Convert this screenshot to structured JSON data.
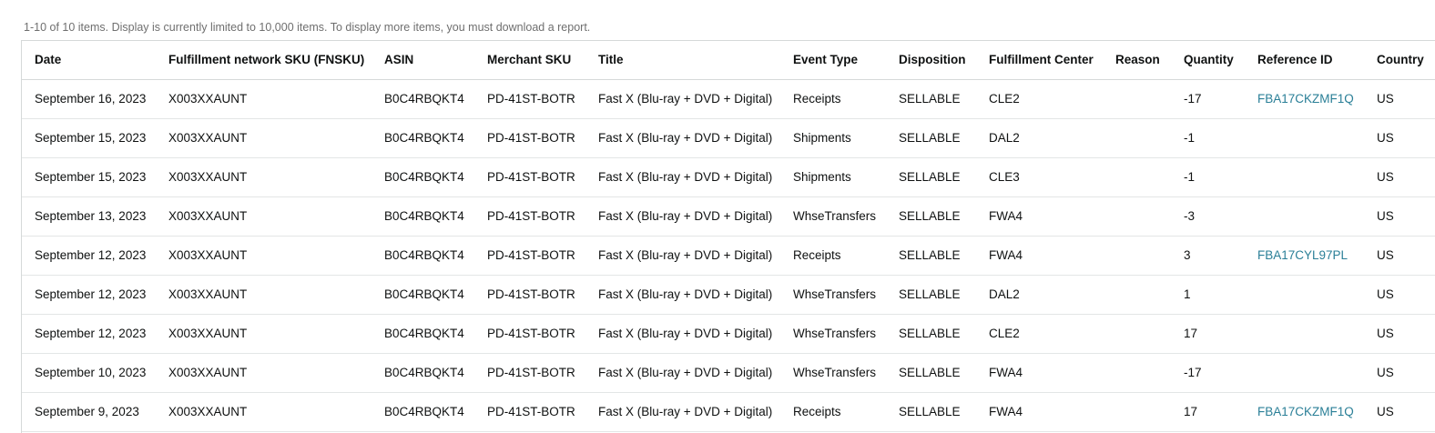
{
  "notice": "1-10 of 10 items. Display is currently limited to 10,000 items. To display more items, you must download a report.",
  "columns": {
    "date": "Date",
    "fnsku": "Fulfillment network SKU (FNSKU)",
    "asin": "ASIN",
    "merchant_sku": "Merchant SKU",
    "title": "Title",
    "event_type": "Event Type",
    "disposition": "Disposition",
    "fulfillment_center": "Fulfillment Center",
    "reason": "Reason",
    "quantity": "Quantity",
    "reference_id": "Reference ID",
    "country": "Country"
  },
  "rows": [
    {
      "date": "September 16, 2023",
      "fnsku": "X003XXAUNT",
      "asin": "B0C4RBQKT4",
      "merchant_sku": "PD-41ST-BOTR",
      "title": "Fast X (Blu-ray + DVD + Digital)",
      "event_type": "Receipts",
      "disposition": "SELLABLE",
      "fulfillment_center": "CLE2",
      "reason": "",
      "quantity": "-17",
      "reference_id": "FBA17CKZMF1Q",
      "country": "US"
    },
    {
      "date": "September 15, 2023",
      "fnsku": "X003XXAUNT",
      "asin": "B0C4RBQKT4",
      "merchant_sku": "PD-41ST-BOTR",
      "title": "Fast X (Blu-ray + DVD + Digital)",
      "event_type": "Shipments",
      "disposition": "SELLABLE",
      "fulfillment_center": "DAL2",
      "reason": "",
      "quantity": "-1",
      "reference_id": "",
      "country": "US"
    },
    {
      "date": "September 15, 2023",
      "fnsku": "X003XXAUNT",
      "asin": "B0C4RBQKT4",
      "merchant_sku": "PD-41ST-BOTR",
      "title": "Fast X (Blu-ray + DVD + Digital)",
      "event_type": "Shipments",
      "disposition": "SELLABLE",
      "fulfillment_center": "CLE3",
      "reason": "",
      "quantity": "-1",
      "reference_id": "",
      "country": "US"
    },
    {
      "date": "September 13, 2023",
      "fnsku": "X003XXAUNT",
      "asin": "B0C4RBQKT4",
      "merchant_sku": "PD-41ST-BOTR",
      "title": "Fast X (Blu-ray + DVD + Digital)",
      "event_type": "WhseTransfers",
      "disposition": "SELLABLE",
      "fulfillment_center": "FWA4",
      "reason": "",
      "quantity": "-3",
      "reference_id": "",
      "country": "US"
    },
    {
      "date": "September 12, 2023",
      "fnsku": "X003XXAUNT",
      "asin": "B0C4RBQKT4",
      "merchant_sku": "PD-41ST-BOTR",
      "title": "Fast X (Blu-ray + DVD + Digital)",
      "event_type": "Receipts",
      "disposition": "SELLABLE",
      "fulfillment_center": "FWA4",
      "reason": "",
      "quantity": "3",
      "reference_id": "FBA17CYL97PL",
      "country": "US"
    },
    {
      "date": "September 12, 2023",
      "fnsku": "X003XXAUNT",
      "asin": "B0C4RBQKT4",
      "merchant_sku": "PD-41ST-BOTR",
      "title": "Fast X (Blu-ray + DVD + Digital)",
      "event_type": "WhseTransfers",
      "disposition": "SELLABLE",
      "fulfillment_center": "DAL2",
      "reason": "",
      "quantity": "1",
      "reference_id": "",
      "country": "US"
    },
    {
      "date": "September 12, 2023",
      "fnsku": "X003XXAUNT",
      "asin": "B0C4RBQKT4",
      "merchant_sku": "PD-41ST-BOTR",
      "title": "Fast X (Blu-ray + DVD + Digital)",
      "event_type": "WhseTransfers",
      "disposition": "SELLABLE",
      "fulfillment_center": "CLE2",
      "reason": "",
      "quantity": "17",
      "reference_id": "",
      "country": "US"
    },
    {
      "date": "September 10, 2023",
      "fnsku": "X003XXAUNT",
      "asin": "B0C4RBQKT4",
      "merchant_sku": "PD-41ST-BOTR",
      "title": "Fast X (Blu-ray + DVD + Digital)",
      "event_type": "WhseTransfers",
      "disposition": "SELLABLE",
      "fulfillment_center": "FWA4",
      "reason": "",
      "quantity": "-17",
      "reference_id": "",
      "country": "US"
    },
    {
      "date": "September 9, 2023",
      "fnsku": "X003XXAUNT",
      "asin": "B0C4RBQKT4",
      "merchant_sku": "PD-41ST-BOTR",
      "title": "Fast X (Blu-ray + DVD + Digital)",
      "event_type": "Receipts",
      "disposition": "SELLABLE",
      "fulfillment_center": "FWA4",
      "reason": "",
      "quantity": "17",
      "reference_id": "FBA17CKZMF1Q",
      "country": "US"
    }
  ],
  "colors": {
    "link": "#2a7f97",
    "text": "#0f1111",
    "notice": "#6f6f6f",
    "border": "#d5d9d9"
  }
}
